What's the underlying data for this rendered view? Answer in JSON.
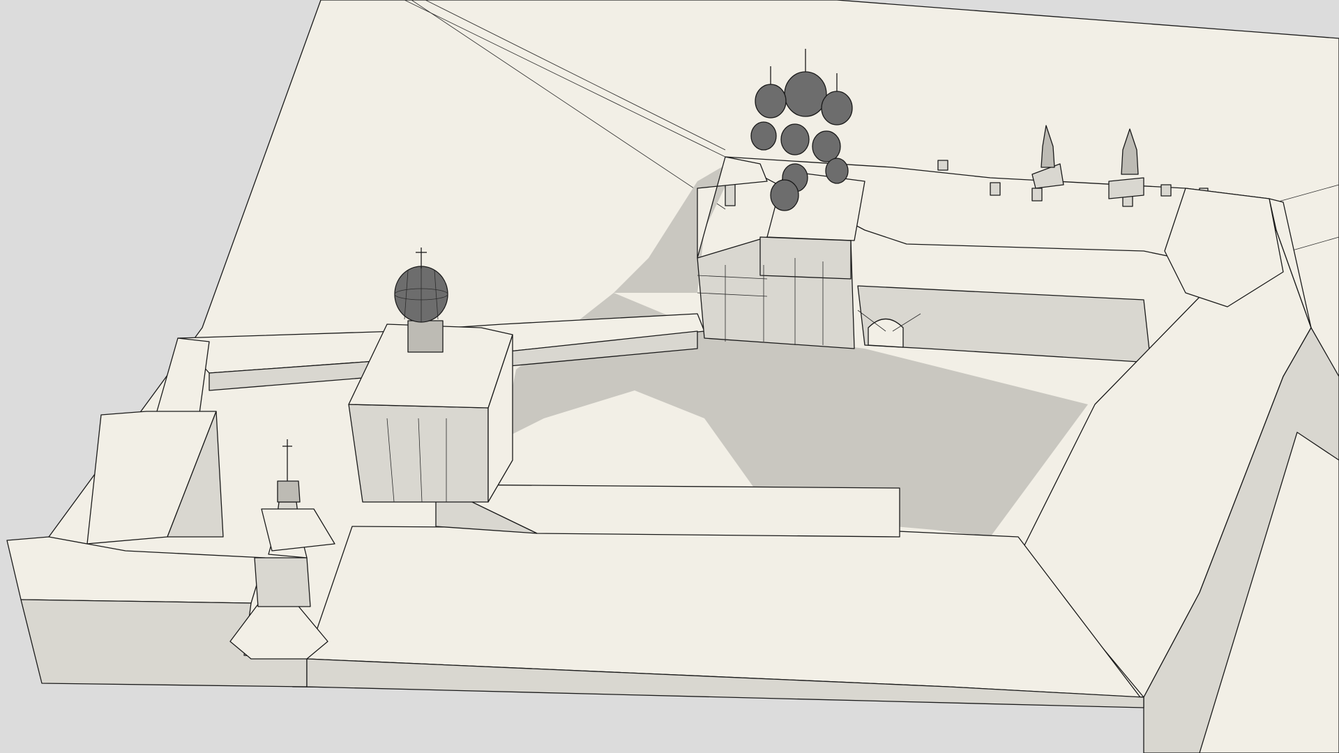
{
  "scene": {
    "kind": "3d-architectural-model",
    "background_color": "#dcdcdc",
    "ground_color": "#f2efe6",
    "wall_light_color": "#f2efe6",
    "wall_shade_color": "#d9d7d0",
    "shadow_color": "#c9c7c0",
    "outline_color": "#1a1a1a",
    "dome_color": "#6d6d6d"
  }
}
